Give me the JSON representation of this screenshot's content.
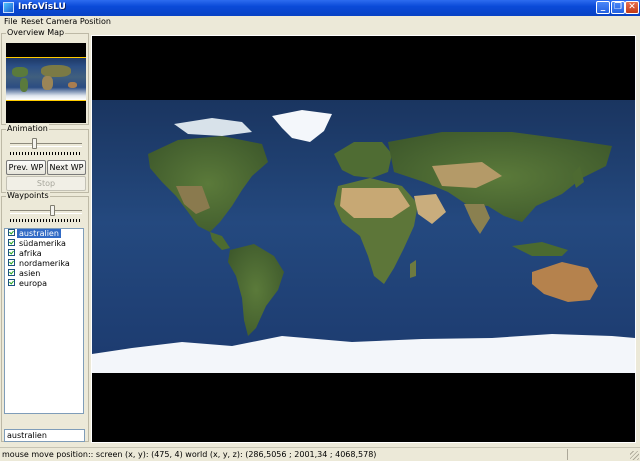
{
  "window": {
    "title": "InfoVisLU"
  },
  "title_controls": {
    "minimize": "_",
    "restore": "❐",
    "close": "✕"
  },
  "menu": {
    "file": "File",
    "reset_camera": "Reset Camera Position"
  },
  "overview": {
    "label": "Overview Map"
  },
  "animation": {
    "label": "Animation",
    "prev_label": "Prev. WP",
    "next_label": "Next WP",
    "stop_label": "Stop",
    "slider_fraction": 0.33
  },
  "waypoints": {
    "label": "Waypoints",
    "slider_fraction": 0.6,
    "items": [
      {
        "label": "australien",
        "checked": true,
        "selected": true
      },
      {
        "label": "südamerika",
        "checked": true,
        "selected": false
      },
      {
        "label": "afrika",
        "checked": true,
        "selected": false
      },
      {
        "label": "nordamerika",
        "checked": true,
        "selected": false
      },
      {
        "label": "asien",
        "checked": true,
        "selected": false
      },
      {
        "label": "europa",
        "checked": true,
        "selected": false
      }
    ],
    "name_value": "australien"
  },
  "status": {
    "text": "mouse move position:: screen (x, y): (475, 4) world (x, y, z): (286,5056 ; 2001,34 ; 4068,578)"
  },
  "colors": {
    "titlebar": "#0a4ad8",
    "selection": "#316ac5",
    "ocean": "#1f3b6b",
    "land": "#4f6d32",
    "desert": "#b99a6a",
    "ice": "#ffffff"
  }
}
